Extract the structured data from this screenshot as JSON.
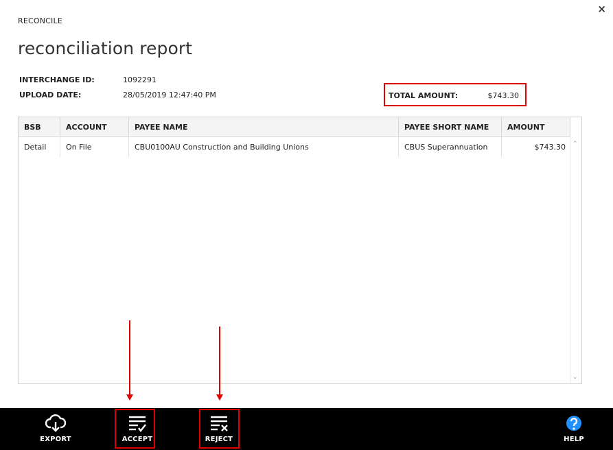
{
  "window": {
    "close_symbol": "×"
  },
  "breadcrumb": "RECONCILE",
  "title": "reconciliation report",
  "meta": {
    "interchange_label": "INTERCHANGE ID:",
    "interchange_value": "1092291",
    "upload_label": "UPLOAD DATE:",
    "upload_value": "28/05/2019 12:47:40 PM",
    "total_label": "TOTAL AMOUNT:",
    "total_value": "$743.30"
  },
  "table": {
    "columns": [
      "BSB",
      "ACCOUNT",
      "PAYEE NAME",
      "PAYEE SHORT NAME",
      "AMOUNT"
    ],
    "rows": [
      [
        "Detail",
        "On File",
        "CBU0100AU Construction and Building Unions",
        "CBUS Superannuation",
        "$743.30"
      ]
    ]
  },
  "actions": {
    "export": "EXPORT",
    "accept": "ACCEPT",
    "reject": "REJECT",
    "help": "HELP"
  },
  "icons": {
    "export": "cloud-download-icon",
    "accept": "list-check-icon",
    "reject": "list-x-icon",
    "help": "help-circle-icon"
  },
  "colors": {
    "annotation": "#e00000",
    "help": "#1e90ff",
    "bar": "#000000"
  }
}
